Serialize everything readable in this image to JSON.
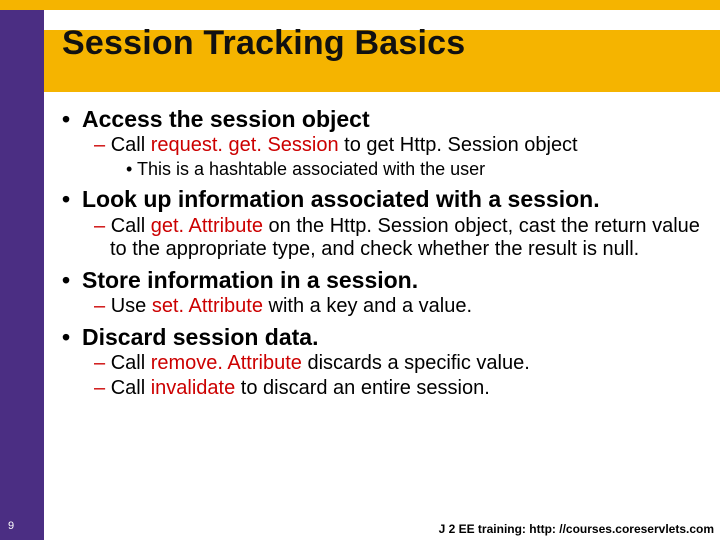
{
  "slide": {
    "title": "Session Tracking Basics",
    "page_number": "9",
    "footer": "J 2 EE training: http: //courses.coreservlets.com",
    "bullets": {
      "b1a": "Access the session object",
      "b2a_pre": "Call ",
      "b2a_red": "request. get. Session",
      "b2a_post": " to get Http. Session object",
      "b3a": "This is a hashtable associated with the user",
      "b1b": "Look up information associated with a session.",
      "b2b_pre": "Call ",
      "b2b_red": "get. Attribute",
      "b2b_post": " on the Http. Session object, cast the return value to the appropriate type, and check whether the result is null.",
      "b1c": "Store information in a session.",
      "b2c_pre": "Use ",
      "b2c_red": "set. Attribute",
      "b2c_post": " with a key and a value.",
      "b1d": "Discard session data.",
      "b2d_pre": "Call ",
      "b2d_red": "remove. Attribute",
      "b2d_post": " discards a specific value.",
      "b2e_pre": "Call ",
      "b2e_red": "invalidate",
      "b2e_post": " to discard an entire session."
    }
  }
}
